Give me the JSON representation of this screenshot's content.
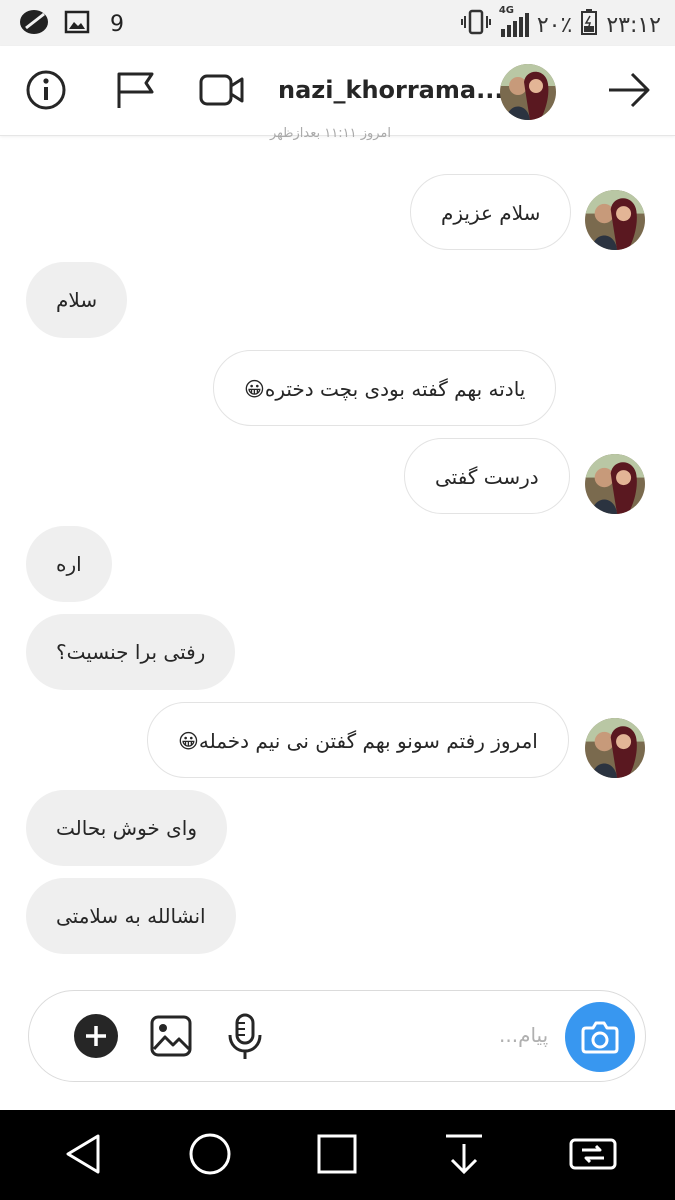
{
  "status_bar": {
    "notification_count": "9",
    "network_type": "4G",
    "battery_percent": "٢٠٪",
    "time": "٢٣:١٢"
  },
  "header": {
    "username": "nazi_khorrama..."
  },
  "partial_timestamp": "امروز ۱۱:۱۱ بعدازظهر",
  "messages": [
    {
      "side": "received",
      "text": "سلام عزیزم",
      "avatar": true
    },
    {
      "side": "sent",
      "text": "سلام"
    },
    {
      "side": "received",
      "text": "یادته بهم گفته بودی بچت دختره😀"
    },
    {
      "side": "received",
      "text": "درست گفتی",
      "avatar": true
    },
    {
      "side": "sent",
      "text": "اره"
    },
    {
      "side": "sent",
      "text": "رفتی برا جنسیت؟"
    },
    {
      "side": "received",
      "text": "امروز رفتم سونو بهم گفتن نی نیم دخمله😀",
      "avatar": true
    },
    {
      "side": "sent",
      "text": "وای خوش بحالت"
    },
    {
      "side": "sent",
      "text": "انشالله به سلامتی"
    }
  ],
  "composer": {
    "placeholder": "پیام..."
  },
  "colors": {
    "accent": "#3897f0",
    "sent_bubble": "#efefef",
    "received_border": "#e3e3e3",
    "nav_background": "#000000"
  },
  "icons": {
    "header": [
      "info-icon",
      "flag-icon",
      "video-call-icon",
      "back-arrow-icon"
    ],
    "composer": [
      "add-icon",
      "gallery-icon",
      "microphone-icon",
      "camera-icon"
    ],
    "nav": [
      "back-icon",
      "home-icon",
      "recents-icon",
      "download-icon",
      "switch-icon"
    ]
  }
}
